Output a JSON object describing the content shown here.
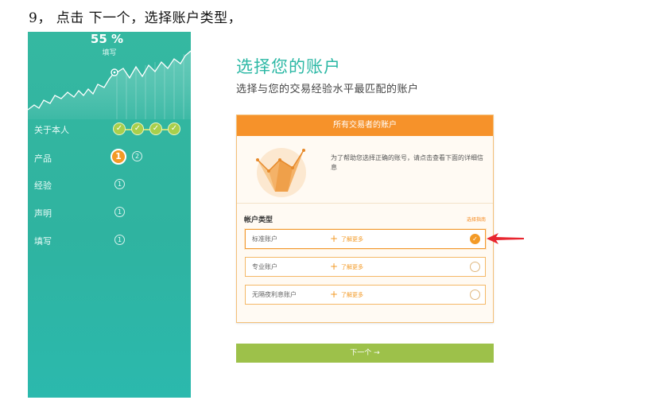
{
  "instruction": "9， 点击 下一个，选择账户类型，",
  "sidebar": {
    "progress_text": "55 %",
    "progress_value": 55,
    "progress_label": "填写",
    "steps": [
      {
        "label": "关于本人",
        "status": "done"
      },
      {
        "label": "产品",
        "status": "active",
        "current": "1",
        "next": "2"
      },
      {
        "label": "经验",
        "status": "pending",
        "badge": "1"
      },
      {
        "label": "声明",
        "status": "pending",
        "badge": "1"
      },
      {
        "label": "填写",
        "status": "pending",
        "badge": "1"
      }
    ],
    "colors": {
      "background": "#2fb3a0",
      "check": "#a9cf4c",
      "active": "#f39a26"
    }
  },
  "main": {
    "title": "选择您的账户",
    "subtitle": "选择与您的交易经验水平最匹配的账户",
    "card": {
      "header": "所有交易者的账户",
      "description": "为了帮助您选择正确的账号，请点击查看下面的详细信息",
      "account_type_label": "帐户类型",
      "help_link": "选择指南",
      "options": [
        {
          "name": "标准账户",
          "more": "了解更多",
          "selected": true
        },
        {
          "name": "专业账户",
          "more": "了解更多",
          "selected": false
        },
        {
          "name": "无隔夜利息账户",
          "more": "了解更多",
          "selected": false
        }
      ]
    },
    "next_button": "下一个 →"
  },
  "colors": {
    "accent": "#2cb8a5",
    "orange": "#f6922a",
    "green_button": "#9dc14a",
    "arrow": "#e8262f"
  }
}
